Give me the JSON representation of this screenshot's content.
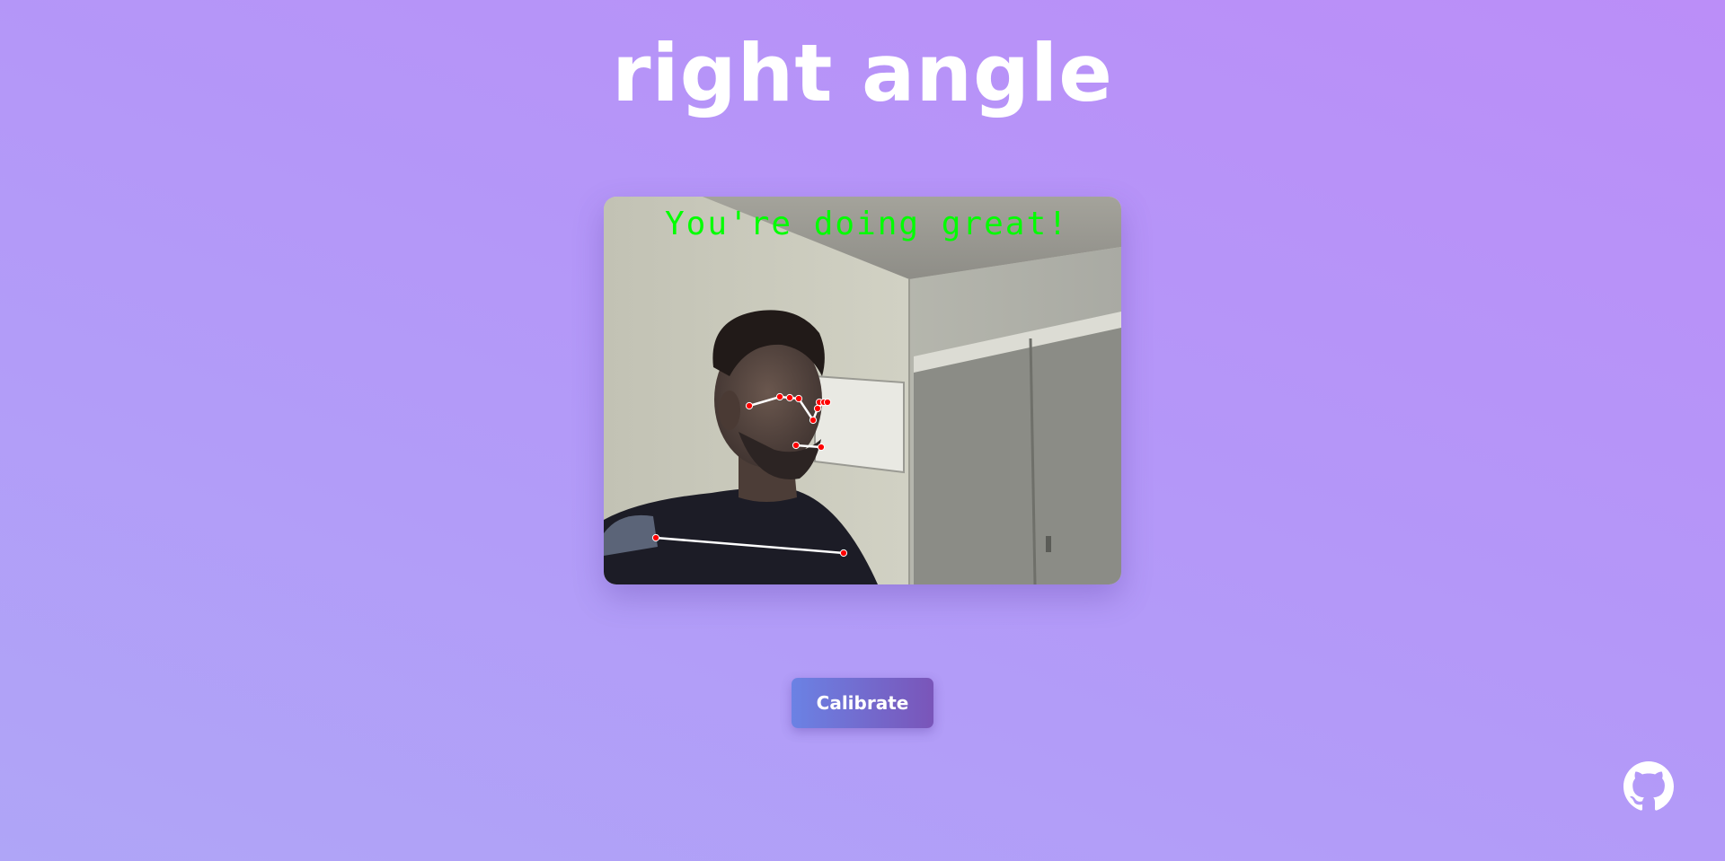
{
  "app": {
    "title": "right angle"
  },
  "camera": {
    "overlay_text": "You're doing great!",
    "overlay_color": "#00ff00",
    "landmark_color": "#ff0000",
    "line_color": "#ffffff"
  },
  "actions": {
    "calibrate_label": "Calibrate"
  },
  "footer": {
    "github_icon": "github-icon"
  },
  "colors": {
    "background_start": "#afa5f7",
    "background_end": "#bb8ef8",
    "button_start": "#6b82e4",
    "button_end": "#7a55b9",
    "text": "#ffffff"
  }
}
